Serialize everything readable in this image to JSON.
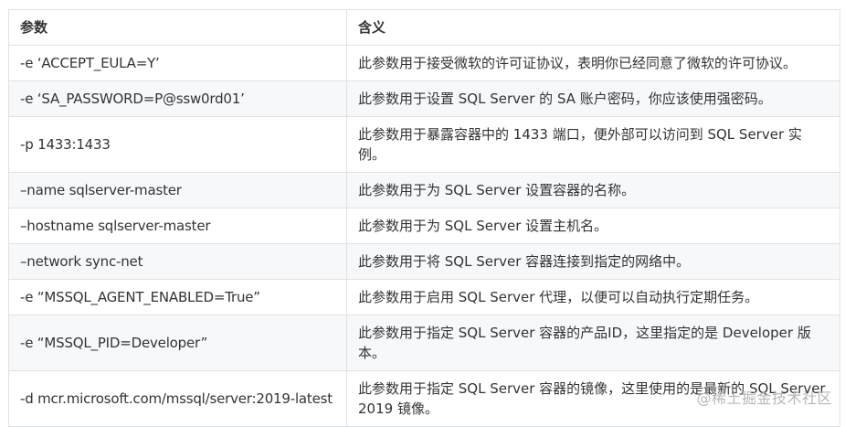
{
  "table": {
    "headers": [
      "参数",
      "含义"
    ],
    "rows": [
      {
        "param": "-e   ‘ACCEPT_EULA=Y’",
        "meaning": "此参数用于接受微软的许可证协议，表明你已经同意了微软的许可协议。"
      },
      {
        "param": "-e   ‘SA_PASSWORD=P@ssw0rd01’",
        "meaning": "此参数用于设置 SQL Server 的 SA 账户密码，你应该使用强密码。"
      },
      {
        "param": "-p 1433:1433",
        "meaning": "此参数用于暴露容器中的 1433 端口，便外部可以访问到 SQL Server 实例。"
      },
      {
        "param": "–name sqlserver-master",
        "meaning": "此参数用于为 SQL Server 设置容器的名称。"
      },
      {
        "param": "–hostname sqlserver-master",
        "meaning": "此参数用于为 SQL Server 设置主机名。"
      },
      {
        "param": "–network sync-net",
        "meaning": "此参数用于将 SQL Server 容器连接到指定的网络中。"
      },
      {
        "param": "-e   “MSSQL_AGENT_ENABLED=True”",
        "meaning": "此参数用于启用 SQL Server 代理，以便可以自动执行定期任务。"
      },
      {
        "param": "-e   “MSSQL_PID=Developer”",
        "meaning": "此参数用于指定 SQL Server 容器的产品ID，这里指定的是 Developer 版本。"
      },
      {
        "param": "-d mcr.microsoft.com/mssql/server:2019-latest",
        "meaning": "此参数用于指定 SQL Server 容器的镜像，这里使用的是最新的 SQL Server 2019 镜像。"
      }
    ]
  },
  "watermark": "@稀土掘金技术社区"
}
